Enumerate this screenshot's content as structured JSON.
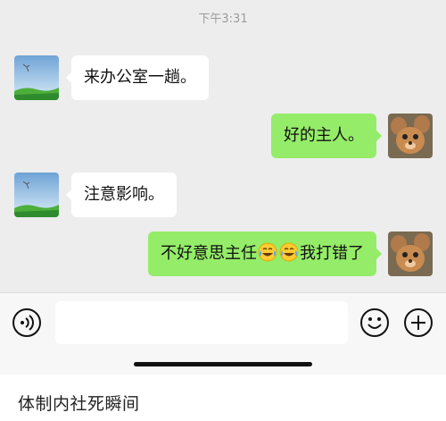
{
  "chat": {
    "timestamp": "下午3:31",
    "messages": [
      {
        "side": "in",
        "text": "来办公室一趟。"
      },
      {
        "side": "out",
        "text": "好的主人。"
      },
      {
        "side": "in",
        "text": "注意影响。"
      },
      {
        "side": "out",
        "text_before": "不好意思主任",
        "emoji": "crying-laughing-emoji",
        "text_after": "我打错了"
      }
    ]
  },
  "input_bar": {
    "voice_icon": "voice-icon",
    "input_value": "",
    "emoji_icon": "smiley-icon",
    "add_icon": "plus-icon"
  },
  "caption": "体制内社死瞬间",
  "colors": {
    "chat_background": "#ededed",
    "incoming_bubble": "#ffffff",
    "outgoing_bubble": "#95ec69",
    "input_bar_background": "#f7f7f7"
  }
}
